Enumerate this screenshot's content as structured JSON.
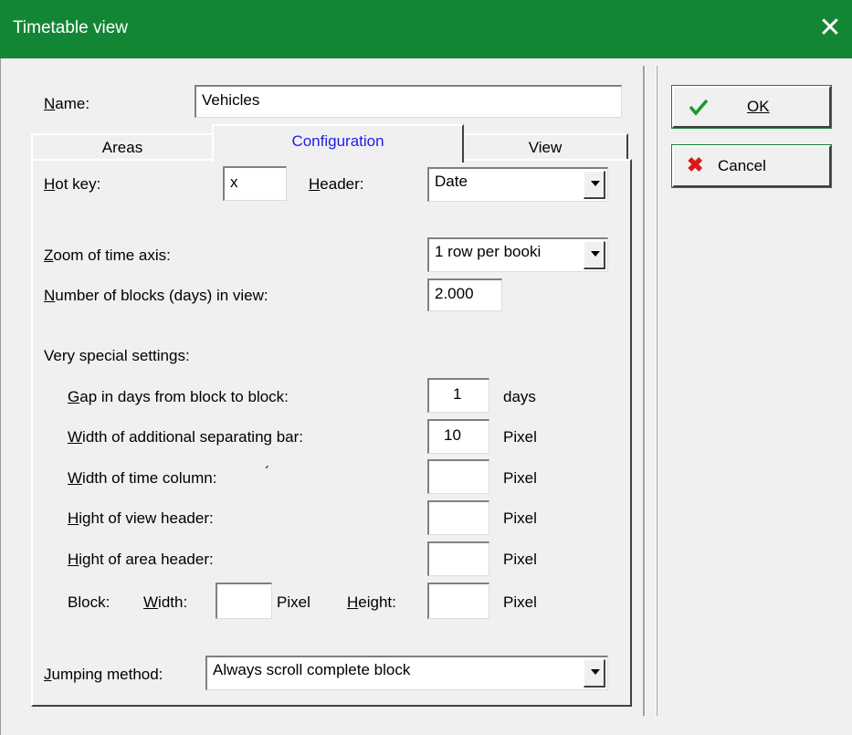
{
  "window": {
    "title": "Timetable view",
    "close_symbol": "✕"
  },
  "name_field": {
    "label": "Name:",
    "value": "Vehicles"
  },
  "tabs": [
    {
      "label": "Areas"
    },
    {
      "label": "Configuration"
    },
    {
      "label": "View"
    }
  ],
  "config": {
    "hot_key": {
      "label": "Hot key:",
      "value": "x"
    },
    "header": {
      "label": "Header:",
      "value": "Date"
    },
    "zoom": {
      "label": "Zoom of time axis:",
      "value": "1 row per booki"
    },
    "blocks_in_view": {
      "label": "Number of blocks (days) in view:",
      "value": "2.000"
    },
    "special_heading": "Very special settings:",
    "gap": {
      "label": "Gap in days from block to block:",
      "value": "1",
      "unit": "days"
    },
    "sep_bar": {
      "label": "Width of additional separating bar:",
      "value": "10",
      "unit": "Pixel"
    },
    "time_col": {
      "label": "Width of time column:",
      "mark": "´",
      "value": "",
      "unit": "Pixel"
    },
    "view_header": {
      "label": "Hight of view header:",
      "value": "",
      "unit": "Pixel"
    },
    "area_header": {
      "label": "Hight of area header:",
      "value": "",
      "unit": "Pixel"
    },
    "block": {
      "label": "Block:",
      "width_label": "Width:",
      "width_value": "",
      "width_unit": "Pixel",
      "height_label": "Height:",
      "height_value": "",
      "height_unit": "Pixel"
    },
    "jumping": {
      "label": "Jumping method:",
      "value": "Always scroll complete block"
    }
  },
  "buttons": {
    "ok": "OK",
    "cancel": "Cancel"
  },
  "colors": {
    "titlebar": "#138636",
    "tab_active_text": "#1e1ee6",
    "cancel_icon": "#d71b1b",
    "ok_icon": "#1c9a2e"
  }
}
